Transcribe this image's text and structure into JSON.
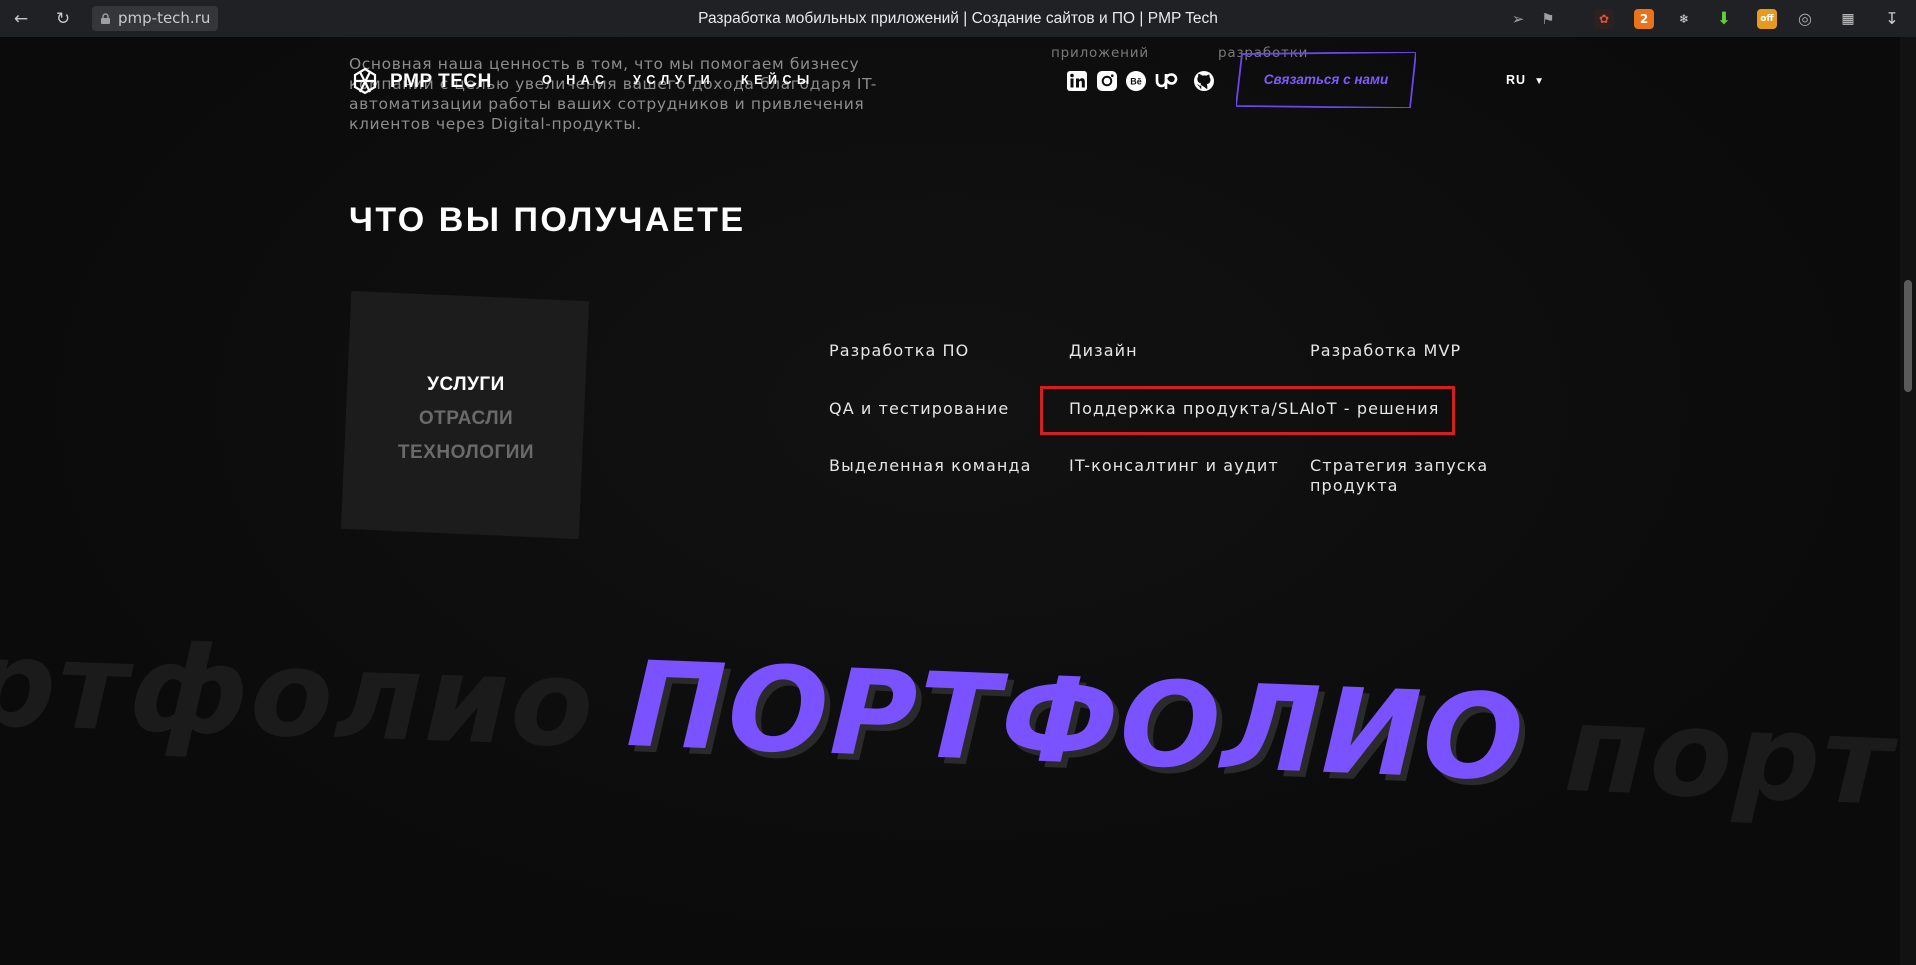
{
  "browser": {
    "url": "pmp-tech.ru",
    "tab_title": "Разработка мобильных приложений | Создание сайтов и ПО | PMP Tech",
    "extension_badge": "2",
    "extension_off_label": "off"
  },
  "intro_text": "Основная наша ценность в том, что мы помогаем бизнесу компаний с целью увеличения вашего дохода благодаря IT-автоматизации работы ваших сотрудников и привлечения клиентов через Digital-продукты.",
  "cut_labels": [
    "приложений",
    "разработки"
  ],
  "header": {
    "logo_text": "PMP TECH",
    "nav": [
      "О НАС",
      "УСЛУГИ",
      "КЕЙСЫ"
    ],
    "social_icons": [
      "linkedin-icon",
      "instagram-icon",
      "behance-icon",
      "upwork-icon",
      "github-icon"
    ],
    "contact_button": "Связаться с нами",
    "language": "RU"
  },
  "section_title": "ЧТО ВЫ ПОЛУЧАЕТЕ",
  "tabs": [
    {
      "label": "УСЛУГИ",
      "active": true
    },
    {
      "label": "ОТРАСЛИ",
      "active": false
    },
    {
      "label": "ТЕХНОЛОГИИ",
      "active": false
    }
  ],
  "services": [
    "Разработка ПО",
    "Дизайн",
    "Разработка MVP",
    "QA и тестирование",
    "Поддержка продукта/SLA",
    "IoT - решения",
    "Выделенная команда",
    "IT-консалтинг и аудит",
    "Стратегия запуска продукта"
  ],
  "portfolio": {
    "title": "ПОРТФОЛИО",
    "bg_left": "ртфолио",
    "bg_right": "порт"
  },
  "colors": {
    "accent": "#7a52ff",
    "highlight": "#d12020",
    "background": "#0d0d0d"
  }
}
